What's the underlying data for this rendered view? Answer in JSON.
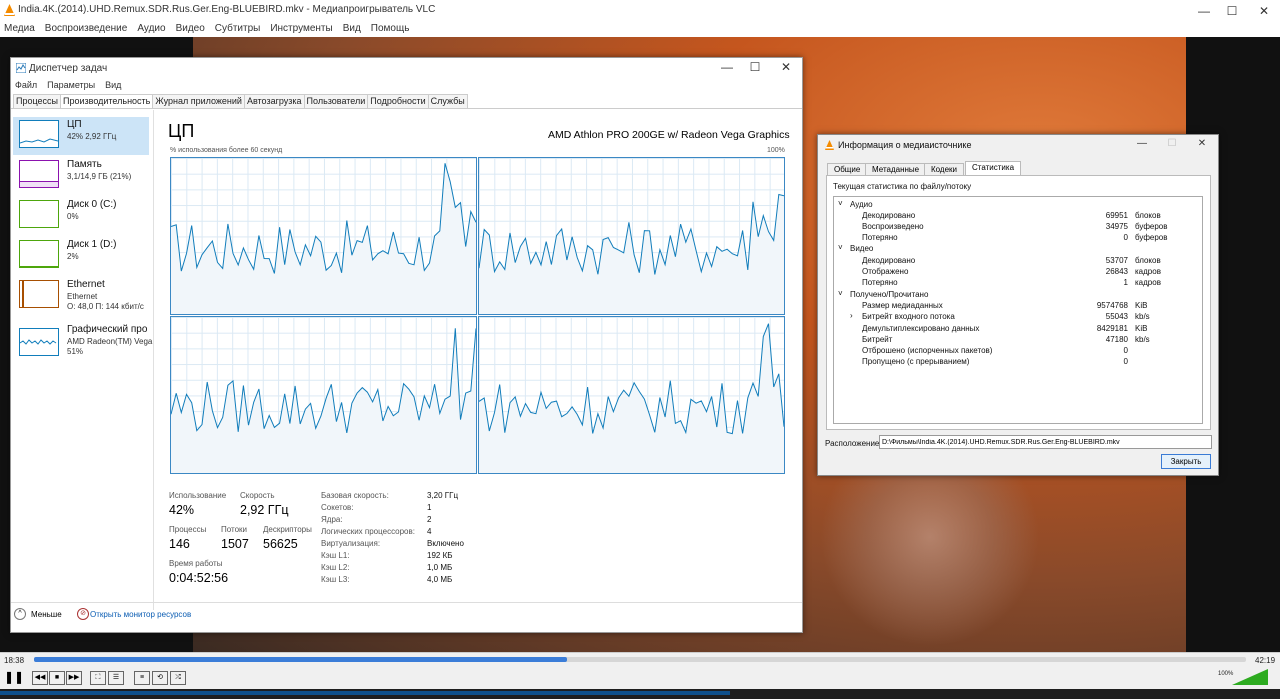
{
  "vlc": {
    "title": "India.4K.(2014).UHD.Remux.SDR.Rus.Ger.Eng-BLUEBIRD.mkv - Медиапроигрыватель VLC",
    "menu": [
      "Медиа",
      "Воспроизведение",
      "Аудио",
      "Видео",
      "Субтитры",
      "Инструменты",
      "Вид",
      "Помощь"
    ],
    "time_elapsed": "18:38",
    "time_total": "42:19",
    "progress": 0.44,
    "volume_label": "100%",
    "volume": 1.0,
    "colors": {
      "progress": "#3b7dd8",
      "accent": "#ff8800"
    }
  },
  "taskmgr": {
    "title": "Диспетчер задач",
    "menu": [
      "Файл",
      "Параметры",
      "Вид"
    ],
    "tabs": [
      "Процессы",
      "Производительность",
      "Журнал приложений",
      "Автозагрузка",
      "Пользователи",
      "Подробности",
      "Службы"
    ],
    "active_tab": 1,
    "sidebar": [
      {
        "name": "ЦП",
        "sub1": "42% 2,92 ГГц",
        "sub2": "",
        "color": "#117dbb"
      },
      {
        "name": "Память",
        "sub1": "3,1/14,9 ГБ (21%)",
        "sub2": "",
        "color": "#8b12ae"
      },
      {
        "name": "Диск 0 (C:)",
        "sub1": "0%",
        "sub2": "",
        "color": "#4da60c"
      },
      {
        "name": "Диск 1 (D:)",
        "sub1": "2%",
        "sub2": "",
        "color": "#4da60c"
      },
      {
        "name": "Ethernet",
        "sub1": "Ethernet",
        "sub2": "О: 48,0 П: 144 кбит/с",
        "color": "#a74f01"
      },
      {
        "name": "Графический про",
        "sub1": "AMD Radeon(TM) Vega",
        "sub2": "51%",
        "color": "#117dbb"
      }
    ],
    "cpu": {
      "heading": "ЦП",
      "model": "AMD Athlon PRO 200GE w/ Radeon Vega Graphics",
      "graph_caption": "% использования более 60 секунд",
      "graph_max": "100%",
      "stats": {
        "usage_label": "Использование",
        "usage": "42%",
        "speed_label": "Скорость",
        "speed": "2,92 ГГц",
        "processes_label": "Процессы",
        "processes": "146",
        "threads_label": "Потоки",
        "threads": "1507",
        "handles_label": "Дескрипторы",
        "handles": "56625",
        "uptime_label": "Время работы",
        "uptime": "0:04:52:56"
      },
      "details": [
        {
          "k": "Базовая скорость:",
          "v": "3,20 ГГц"
        },
        {
          "k": "Сокетов:",
          "v": "1"
        },
        {
          "k": "Ядра:",
          "v": "2"
        },
        {
          "k": "Логических процессоров:",
          "v": "4"
        },
        {
          "k": "Виртуализация:",
          "v": "Включено"
        },
        {
          "k": "Кэш L1:",
          "v": "192 КБ"
        },
        {
          "k": "Кэш L2:",
          "v": "1,0 МБ"
        },
        {
          "k": "Кэш L3:",
          "v": "4,0 МБ"
        }
      ]
    },
    "footer": {
      "less": "Меньше",
      "monitor": "Открыть монитор ресурсов"
    }
  },
  "mediainfo": {
    "title": "Информация о медиаисточнике",
    "tabs": [
      "Общие",
      "Метаданные",
      "Кодеки",
      "Статистика"
    ],
    "active_tab": 3,
    "caption": "Текущая статистика по файлу/потоку",
    "audio": {
      "label": "Аудио",
      "rows": [
        {
          "k": "Декодировано",
          "v": "69951",
          "u": "блоков"
        },
        {
          "k": "Воспроизведено",
          "v": "34975",
          "u": "буферов"
        },
        {
          "k": "Потеряно",
          "v": "0",
          "u": "буферов"
        }
      ]
    },
    "video": {
      "label": "Видео",
      "rows": [
        {
          "k": "Декодировано",
          "v": "53707",
          "u": "блоков"
        },
        {
          "k": "Отображено",
          "v": "26843",
          "u": "кадров"
        },
        {
          "k": "Потеряно",
          "v": "1",
          "u": "кадров"
        }
      ]
    },
    "input": {
      "label": "Получено/Прочитано",
      "rows": [
        {
          "k": "Размер медиаданных",
          "v": "9574768",
          "u": "KiB"
        },
        {
          "k": "Битрейт входного потока",
          "v": "55043",
          "u": "kb/s"
        },
        {
          "k": "Демультиплексировано данных",
          "v": "8429181",
          "u": "KiB"
        },
        {
          "k": "Битрейт",
          "v": "47180",
          "u": "kb/s"
        },
        {
          "k": "Отброшено (испорченных пакетов)",
          "v": "0",
          "u": ""
        },
        {
          "k": "Пропущено (с прерыванием)",
          "v": "0",
          "u": ""
        }
      ]
    },
    "location_label": "Расположение:",
    "location": "D:\\Фильмы\\India.4K.(2014).UHD.Remux.SDR.Rus.Ger.Eng-BLUEBIRD.mkv",
    "close": "Закрыть"
  }
}
